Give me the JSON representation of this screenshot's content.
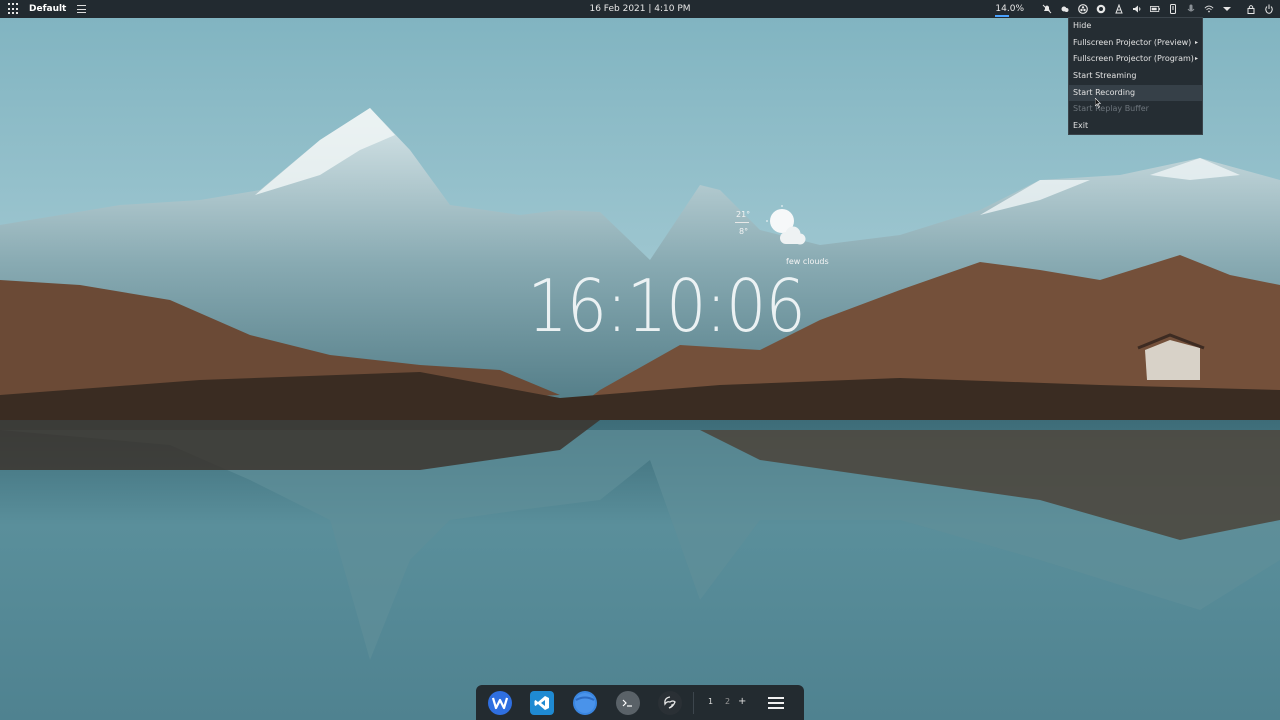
{
  "topbar": {
    "workspace_label": "Default",
    "datetime": "16 Feb 2021 | 4:10 PM",
    "cpu_usage": "14.0%"
  },
  "tray_icons": [
    "bell-off-icon",
    "cloud-icon",
    "obs-icon",
    "record-icon",
    "tower-icon",
    "volume-icon",
    "battery-icon",
    "phone-icon",
    "mic-icon",
    "wifi-icon",
    "dropdown-icon",
    "lock-icon",
    "power-icon"
  ],
  "context_menu": {
    "items": [
      {
        "label": "Hide",
        "has_submenu": false,
        "disabled": false
      },
      {
        "label": "Fullscreen Projector (Preview)",
        "has_submenu": true,
        "disabled": false
      },
      {
        "label": "Fullscreen Projector (Program)",
        "has_submenu": true,
        "disabled": false
      },
      {
        "label": "Start Streaming",
        "has_submenu": false,
        "disabled": false
      },
      {
        "label": "Start Recording",
        "has_submenu": false,
        "disabled": false,
        "highlighted": true
      },
      {
        "label": "Start Replay Buffer",
        "has_submenu": false,
        "disabled": true
      },
      {
        "label": "Exit",
        "has_submenu": false,
        "disabled": false
      }
    ],
    "submenu_arrow": "▸"
  },
  "weather": {
    "high": "21°",
    "low": "8°",
    "description": "few clouds",
    "icon": "few-clouds-icon"
  },
  "clock": {
    "time": "16:10:06"
  },
  "dock": {
    "apps": [
      {
        "name": "wps-office-icon",
        "glyph": "W",
        "color": "#2f6fe0"
      },
      {
        "name": "vscode-icon",
        "glyph": "",
        "color": "#1f8ad2"
      },
      {
        "name": "browser-icon",
        "glyph": "",
        "color": "#3a86e0"
      },
      {
        "name": "terminal-icon",
        "glyph": ">_",
        "color": "#5a6268"
      },
      {
        "name": "obs-studio-icon",
        "glyph": "",
        "color": "#2a3035"
      }
    ],
    "workspaces": [
      "1",
      "2"
    ],
    "add_workspace": "+"
  }
}
